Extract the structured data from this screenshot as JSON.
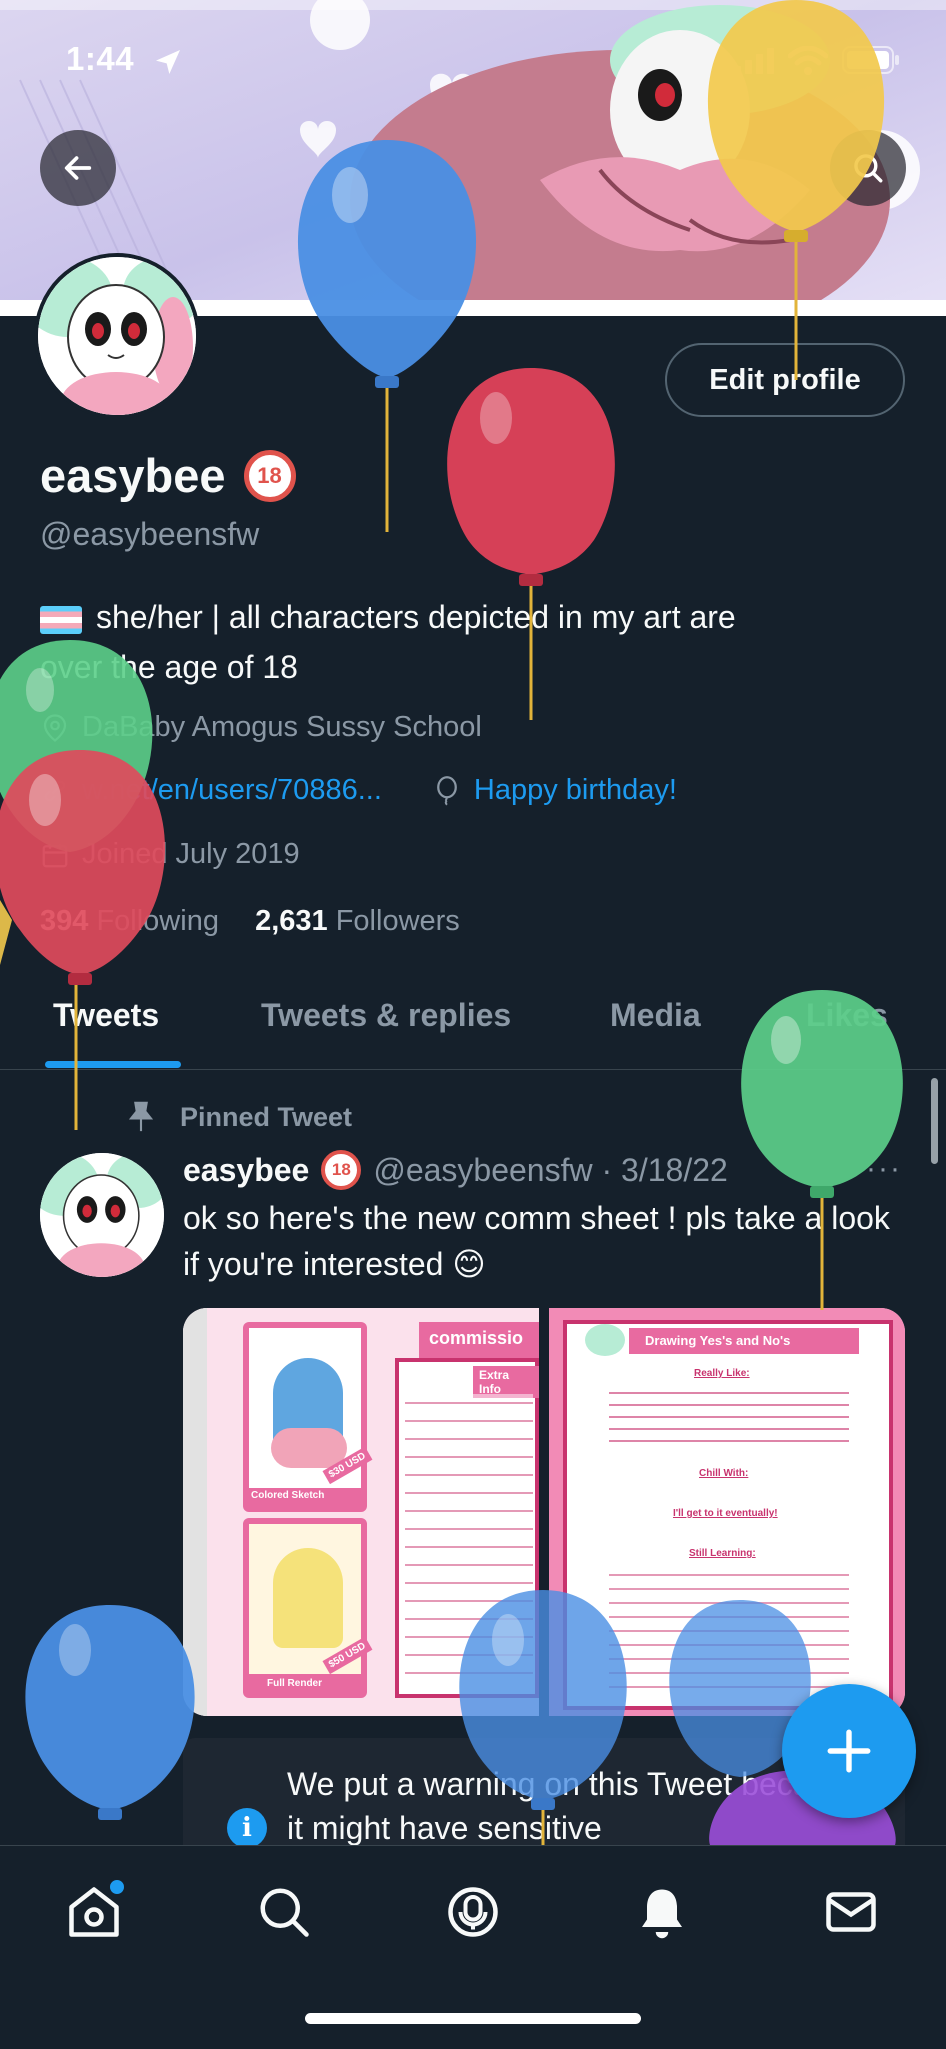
{
  "status_bar": {
    "time": "1:44"
  },
  "profile": {
    "display_name": "easybee",
    "age_badge": "18",
    "handle": "@easybeensfw",
    "bio_line1": "she/her | all characters depicted in my art are",
    "bio_line2": "over the age of 18",
    "location": "DaBaby Amogus Sussy School",
    "website": "w.net/en/users/70886...",
    "birthday": "Happy birthday!",
    "joined": "Joined July 2019",
    "following_count": "394",
    "following_label": "Following",
    "followers_count": "2,631",
    "followers_label": "Followers",
    "edit_button": "Edit profile"
  },
  "tabs": [
    {
      "label": "Tweets",
      "active": true
    },
    {
      "label": "Tweets & replies",
      "active": false
    },
    {
      "label": "Media",
      "active": false
    },
    {
      "label": "Likes",
      "active": false
    }
  ],
  "pinned_tweet": {
    "pinned_label": "Pinned Tweet",
    "author": "easybee",
    "badge": "18",
    "handle_date": "@easybeensfw · 3/18/22",
    "more": "···",
    "text": "ok so here's the new comm sheet ! pls take a look if you're interested 😊",
    "sheet_left_title": "commissio",
    "sheet_left_sub": "Extra Info",
    "sheet_left_price1": "$30 USD",
    "sheet_left_price2": "$50 USD",
    "sheet_left_label1": "Colored Sketch",
    "sheet_left_label2": "Full Render",
    "sheet_right_title": "Drawing Yes's and No's",
    "sheet_right_h1": "Really Like:",
    "sheet_right_h2": "Chill With:",
    "sheet_right_h3": "I'll get to it eventually!",
    "sheet_right_h4": "Still Learning:",
    "warning": "We put a warning on this Tweet because it might have sensitive"
  },
  "nav": {
    "items": [
      "home-icon",
      "search-icon",
      "spaces-icon",
      "notifications-icon",
      "messages-icon"
    ],
    "has_home_dot": true
  },
  "colors": {
    "background": "#15202b",
    "accent": "#1d9bf0",
    "secondary_text": "#8b98a5"
  }
}
